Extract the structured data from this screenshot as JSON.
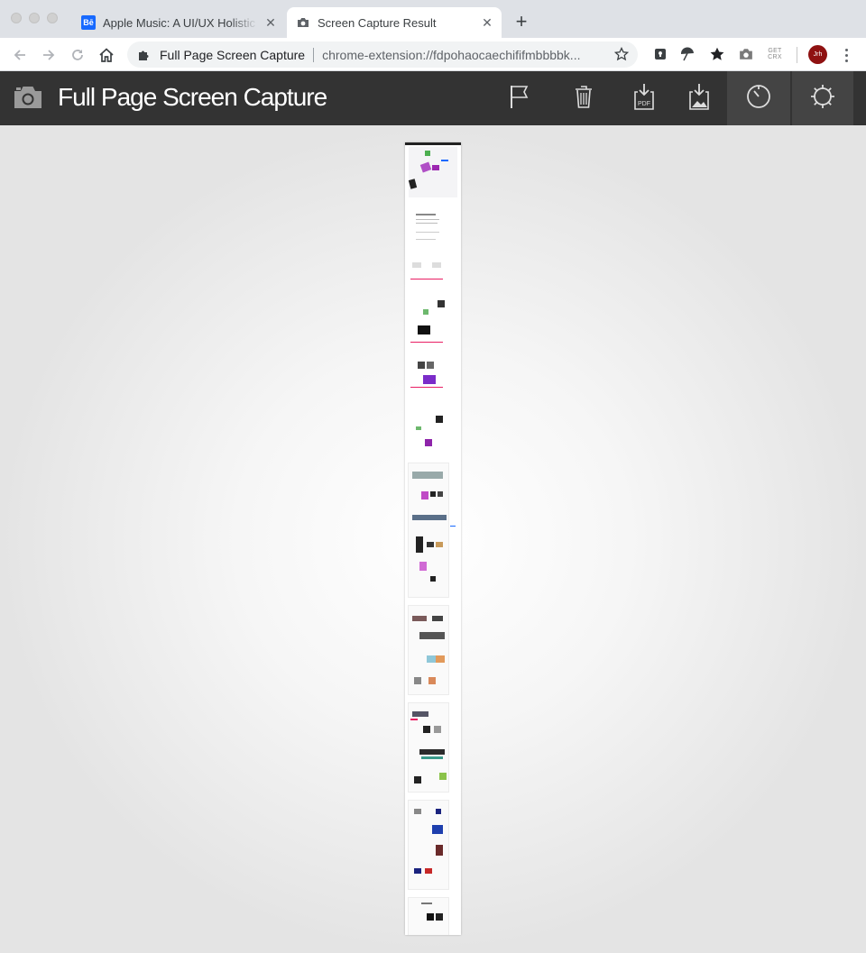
{
  "browser": {
    "tabs": [
      {
        "title": "Apple Music: A UI/UX Holistic C",
        "favicon": "behance-icon",
        "favicon_text": "Bē",
        "active": false
      },
      {
        "title": "Screen Capture Result",
        "favicon": "camera-icon",
        "active": true
      }
    ],
    "close_glyph": "✕",
    "new_tab_glyph": "+",
    "omnibox": {
      "site_name": "Full Page Screen Capture",
      "url": "chrome-extension://fdpohaocaechififmbbbbk..."
    },
    "extensions": [
      "pocket-icon",
      "umbrella-icon",
      "bookmark-star-icon",
      "camera-icon",
      "get-crx-icon"
    ],
    "getcrx_label": "GET CRX",
    "profile_initials": "Jrh"
  },
  "app": {
    "title": "Full Page Screen Capture",
    "toolbar": [
      "flag-icon",
      "trash-icon",
      "download-pdf-icon",
      "download-image-icon",
      "timer-icon",
      "settings-icon"
    ],
    "pdf_label": "PDF"
  },
  "colors": {
    "appbar": "#333333",
    "stage_background": "#e6e6e6",
    "behance_blue": "#1769ff",
    "profile_red": "#8f1111"
  }
}
